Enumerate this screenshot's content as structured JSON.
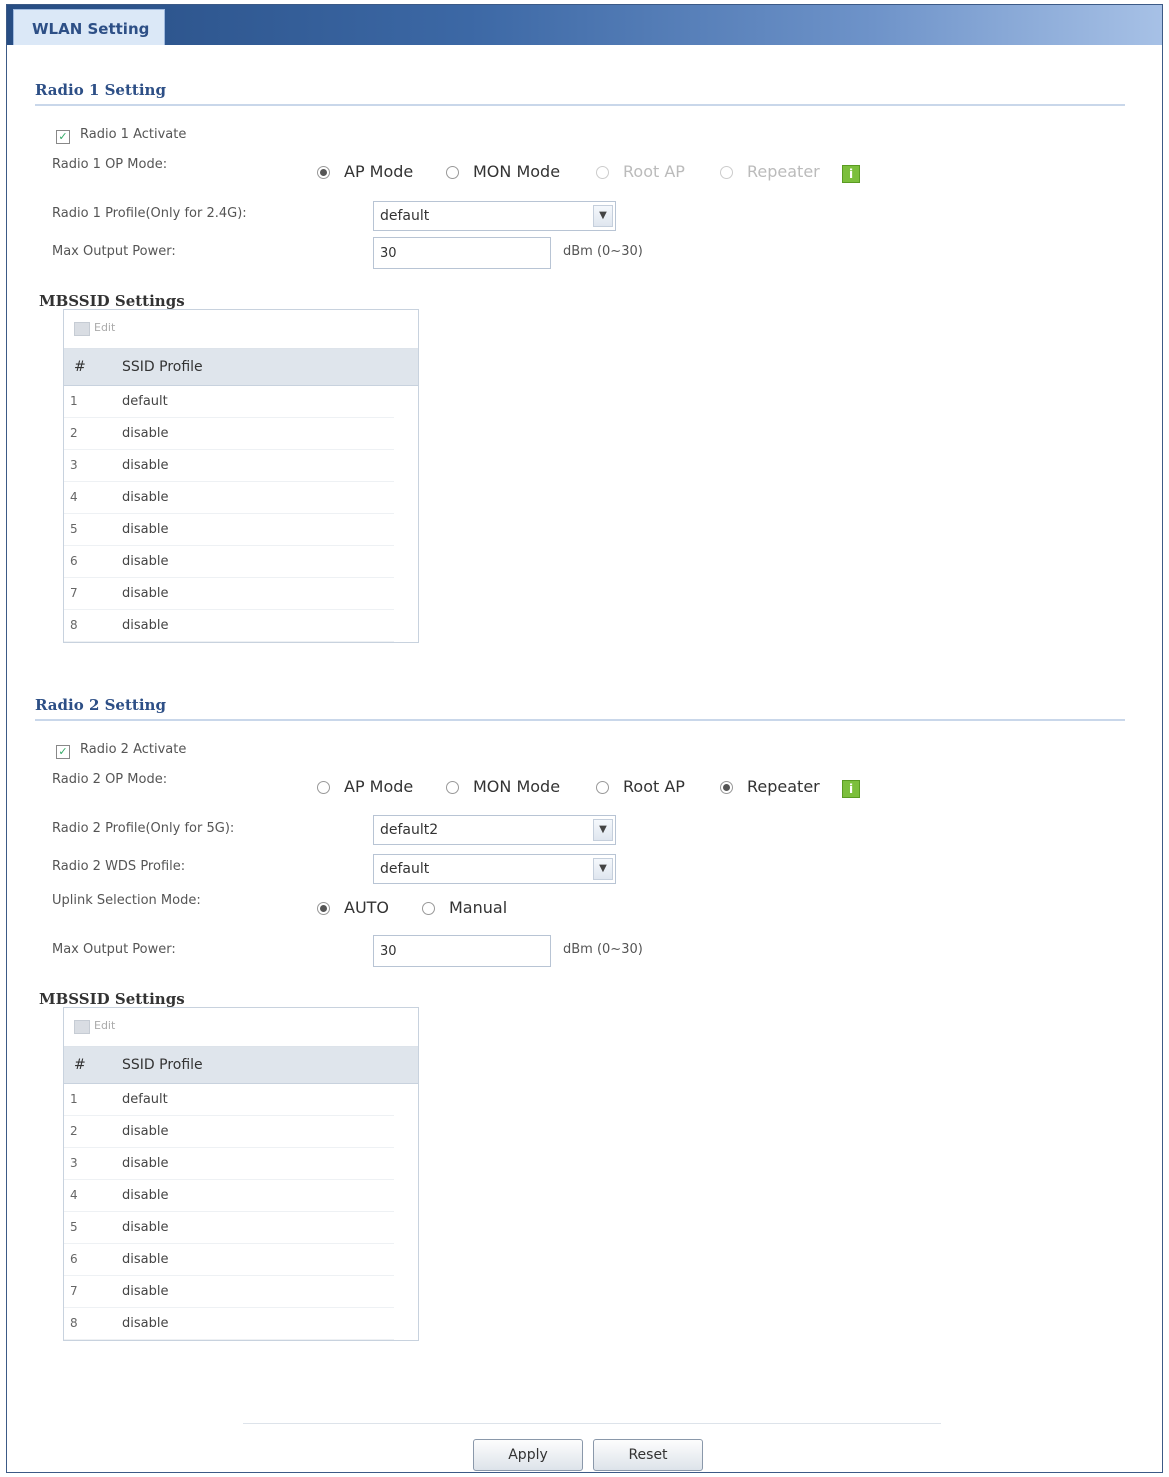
{
  "tab": {
    "label": "WLAN Setting"
  },
  "radio1": {
    "title": "Radio 1 Setting",
    "activate_label": "Radio 1 Activate",
    "activate_checked": true,
    "op_mode_label": "Radio 1 OP Mode:",
    "op_modes": [
      {
        "label": "AP Mode",
        "selected": true,
        "disabled": false
      },
      {
        "label": "MON Mode",
        "selected": false,
        "disabled": false
      },
      {
        "label": "Root AP",
        "selected": false,
        "disabled": true
      },
      {
        "label": "Repeater",
        "selected": false,
        "disabled": true
      }
    ],
    "profile_label": "Radio 1 Profile(Only for 2.4G):",
    "profile_value": "default",
    "max_power_label": "Max Output Power:",
    "max_power_value": "30",
    "max_power_unit": "dBm (0~30)",
    "mbssid": {
      "title": "MBSSID Settings",
      "edit_label": "Edit",
      "columns": [
        "#",
        "SSID Profile"
      ],
      "rows": [
        {
          "n": "1",
          "profile": "default"
        },
        {
          "n": "2",
          "profile": "disable"
        },
        {
          "n": "3",
          "profile": "disable"
        },
        {
          "n": "4",
          "profile": "disable"
        },
        {
          "n": "5",
          "profile": "disable"
        },
        {
          "n": "6",
          "profile": "disable"
        },
        {
          "n": "7",
          "profile": "disable"
        },
        {
          "n": "8",
          "profile": "disable"
        }
      ]
    }
  },
  "radio2": {
    "title": "Radio 2 Setting",
    "activate_label": "Radio 2 Activate",
    "activate_checked": true,
    "op_mode_label": "Radio 2 OP Mode:",
    "op_modes": [
      {
        "label": "AP Mode",
        "selected": false,
        "disabled": false
      },
      {
        "label": "MON Mode",
        "selected": false,
        "disabled": false
      },
      {
        "label": "Root AP",
        "selected": false,
        "disabled": false
      },
      {
        "label": "Repeater",
        "selected": true,
        "disabled": false
      }
    ],
    "profile_label": "Radio 2 Profile(Only for 5G):",
    "profile_value": "default2",
    "wds_label": "Radio 2 WDS Profile:",
    "wds_value": "default",
    "uplink_label": "Uplink Selection Mode:",
    "uplink_modes": [
      {
        "label": "AUTO",
        "selected": true
      },
      {
        "label": "Manual",
        "selected": false
      }
    ],
    "max_power_label": "Max Output Power:",
    "max_power_value": "30",
    "max_power_unit": "dBm (0~30)",
    "mbssid": {
      "title": "MBSSID Settings",
      "edit_label": "Edit",
      "columns": [
        "#",
        "SSID Profile"
      ],
      "rows": [
        {
          "n": "1",
          "profile": "default"
        },
        {
          "n": "2",
          "profile": "disable"
        },
        {
          "n": "3",
          "profile": "disable"
        },
        {
          "n": "4",
          "profile": "disable"
        },
        {
          "n": "5",
          "profile": "disable"
        },
        {
          "n": "6",
          "profile": "disable"
        },
        {
          "n": "7",
          "profile": "disable"
        },
        {
          "n": "8",
          "profile": "disable"
        }
      ]
    }
  },
  "buttons": {
    "apply": "Apply",
    "reset": "Reset"
  },
  "icons": {
    "info": "info-icon",
    "edit": "edit-icon",
    "dropdown": "chevron-down-icon",
    "check": "checkmark-icon"
  }
}
